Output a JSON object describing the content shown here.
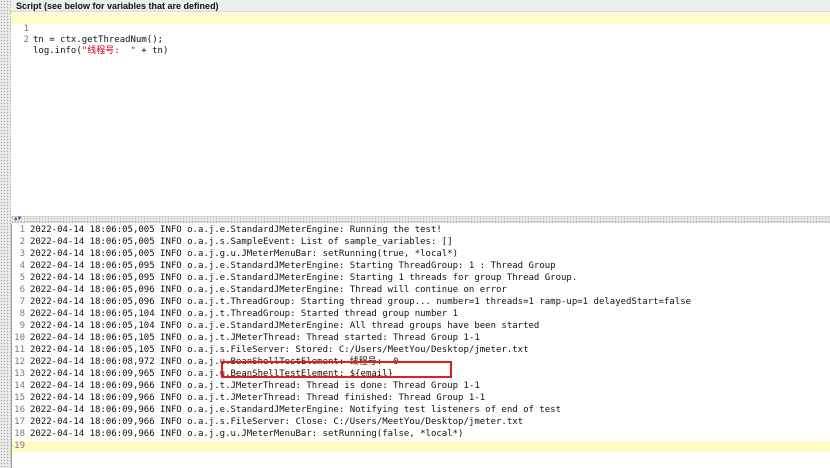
{
  "script_panel": {
    "header": "Script (see below for variables that are defined)",
    "lines": [
      {
        "num": "1",
        "text": "tn = ctx.getThreadNum();"
      },
      {
        "num": "2",
        "pre": "log.info(",
        "str": "\"线程号:  \"",
        "post": " + tn)"
      }
    ]
  },
  "log_panel": {
    "lines": [
      {
        "num": "1",
        "text": "2022-04-14 18:06:05,005 INFO o.a.j.e.StandardJMeterEngine: Running the test!"
      },
      {
        "num": "2",
        "text": "2022-04-14 18:06:05,005 INFO o.a.j.s.SampleEvent: List of sample_variables: []"
      },
      {
        "num": "3",
        "text": "2022-04-14 18:06:05,005 INFO o.a.j.g.u.JMeterMenuBar: setRunning(true, *local*)"
      },
      {
        "num": "4",
        "text": "2022-04-14 18:06:05,095 INFO o.a.j.e.StandardJMeterEngine: Starting ThreadGroup: 1 : Thread Group"
      },
      {
        "num": "5",
        "text": "2022-04-14 18:06:05,095 INFO o.a.j.e.StandardJMeterEngine: Starting 1 threads for group Thread Group."
      },
      {
        "num": "6",
        "text": "2022-04-14 18:06:05,096 INFO o.a.j.e.StandardJMeterEngine: Thread will continue on error"
      },
      {
        "num": "7",
        "text": "2022-04-14 18:06:05,096 INFO o.a.j.t.ThreadGroup: Starting thread group... number=1 threads=1 ramp-up=1 delayedStart=false"
      },
      {
        "num": "8",
        "text": "2022-04-14 18:06:05,104 INFO o.a.j.t.ThreadGroup: Started thread group number 1"
      },
      {
        "num": "9",
        "text": "2022-04-14 18:06:05,104 INFO o.a.j.e.StandardJMeterEngine: All thread groups have been started"
      },
      {
        "num": "10",
        "text": "2022-04-14 18:06:05,105 INFO o.a.j.t.JMeterThread: Thread started: Thread Group 1-1"
      },
      {
        "num": "11",
        "text": "2022-04-14 18:06:05,105 INFO o.a.j.s.FileServer: Stored: C:/Users/MeetYou/Desktop/jmeter.txt"
      },
      {
        "num": "12",
        "text": "2022-04-14 18:06:08,972 INFO o.a.j.u.BeanShellTestElement: 线程号:  0"
      },
      {
        "num": "13",
        "text": "2022-04-14 18:06:09,965 INFO o.a.j.u.BeanShellTestElement: ${email}"
      },
      {
        "num": "14",
        "text": "2022-04-14 18:06:09,966 INFO o.a.j.t.JMeterThread: Thread is done: Thread Group 1-1"
      },
      {
        "num": "15",
        "text": "2022-04-14 18:06:09,966 INFO o.a.j.t.JMeterThread: Thread finished: Thread Group 1-1"
      },
      {
        "num": "16",
        "text": "2022-04-14 18:06:09,966 INFO o.a.j.e.StandardJMeterEngine: Notifying test listeners of end of test"
      },
      {
        "num": "17",
        "text": "2022-04-14 18:06:09,966 INFO o.a.j.s.FileServer: Close: C:/Users/MeetYou/Desktop/jmeter.txt"
      },
      {
        "num": "18",
        "text": "2022-04-14 18:06:09,966 INFO o.a.j.g.u.JMeterMenuBar: setRunning(false, *local*)"
      },
      {
        "num": "19",
        "text": ""
      }
    ]
  },
  "colors": {
    "current_line": "#fffcc8",
    "string_literal": "#c8001e",
    "annotation_box": "#e02020"
  },
  "icons": {
    "divider_arrows": "split-arrows-icon"
  }
}
